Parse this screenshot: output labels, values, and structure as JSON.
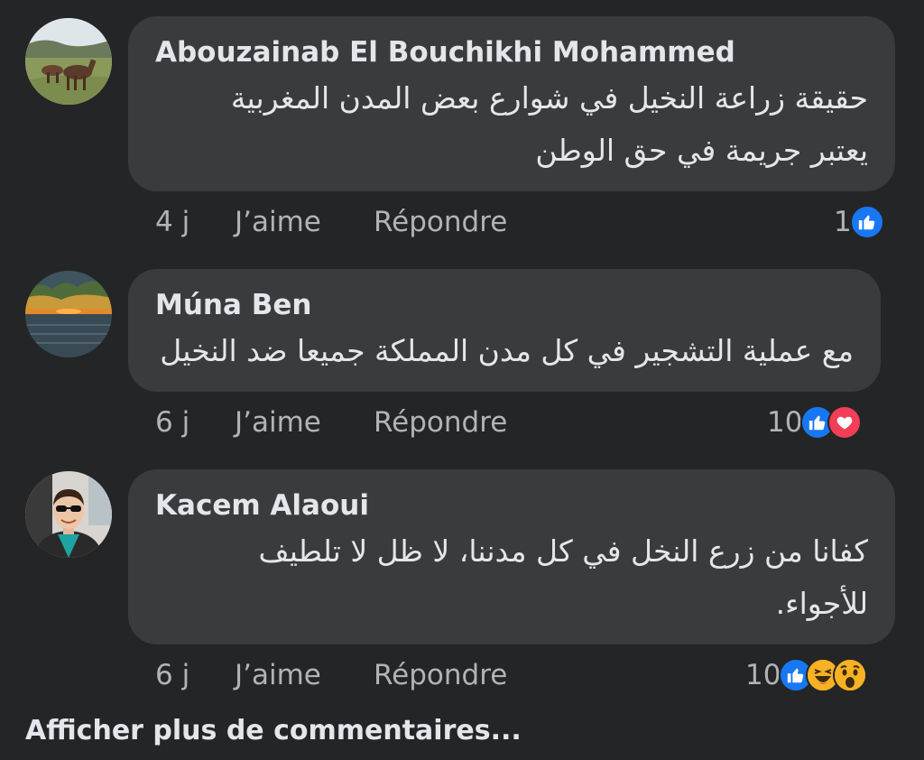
{
  "comments": [
    {
      "author": "Abouzainab El Bouchikhi Mohammed",
      "text_lines": [
        "حقيقة زراعة النخيل في شوارع بعض المدن المغربية",
        "يعتبر جريمة في حق الوطن"
      ],
      "time": "4 j",
      "like_label": "J’aime",
      "reply_label": "Répondre",
      "reaction_count": "1",
      "reactions": [
        "like-icon"
      ],
      "avatar": "avatar-horses-field"
    },
    {
      "author": "Múna Ben",
      "text_lines": [
        "مع عملية التشجير في كل مدن المملكة جميعا ضد النخيل"
      ],
      "time": "6 j",
      "like_label": "J’aime",
      "reply_label": "Répondre",
      "reaction_count": "10",
      "reactions": [
        "like-icon",
        "love-icon"
      ],
      "avatar": "avatar-sunset-sea"
    },
    {
      "author": "Kacem Alaoui",
      "text_lines": [
        "كفانا من زرع النخل في كل مدننا، لا ظل لا تلطيف",
        "للأجواء."
      ],
      "time": "6 j",
      "like_label": "J’aime",
      "reply_label": "Répondre",
      "reaction_count": "10",
      "reactions": [
        "like-icon",
        "haha-icon",
        "wow-icon"
      ],
      "avatar": "avatar-man-sunglasses"
    }
  ],
  "footer": {
    "more_comments_label": "Afficher plus de commentaires..."
  },
  "colors": {
    "background": "#242526",
    "bubble": "#3a3b3c",
    "text_primary": "#e4e6eb",
    "text_secondary": "#b0b3b8",
    "like_blue": "#1877f2",
    "love_red": "#f33e58",
    "haha_yellow": "#f7b125"
  }
}
